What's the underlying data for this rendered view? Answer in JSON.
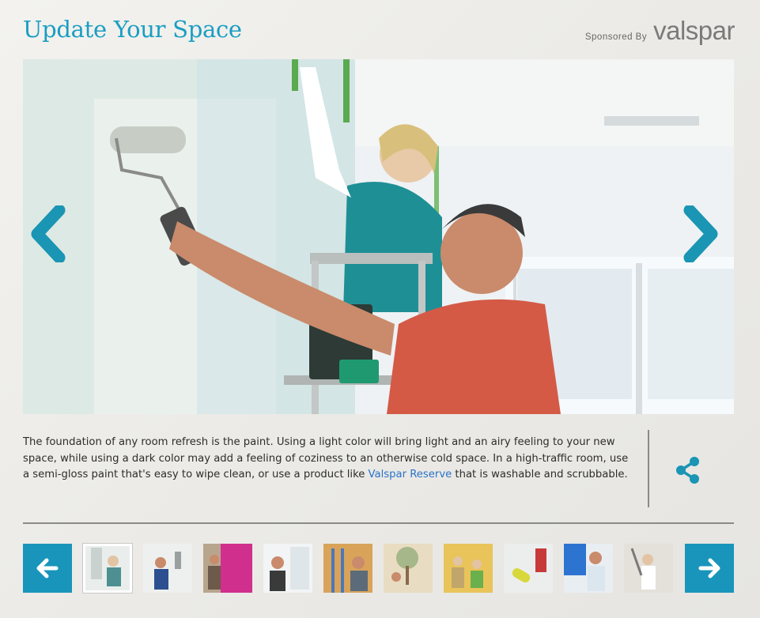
{
  "header": {
    "title": "Update Your Space",
    "sponsored_by": "Sponsored By",
    "brand": "valspar"
  },
  "hero": {
    "prev_icon": "chevron-left-icon",
    "next_icon": "chevron-right-icon",
    "image": "couple-painting-wall-photo"
  },
  "caption": {
    "text_before": "The foundation of any room refresh is the paint. Using a light color will bring light and an airy feeling to your new space, while using a dark color may add a feeling of coziness to an otherwise cold space. In a high-traffic room, use a semi-gloss paint that's easy to wipe clean, or use a product like ",
    "link": "Valspar Reserve",
    "text_after": " that is washable and scrubbable."
  },
  "share": {
    "icon": "share-icon"
  },
  "strip": {
    "prev_icon": "arrow-left-icon",
    "next_icon": "arrow-right-icon",
    "active_index": 0,
    "thumbnails": [
      "woman-painting-thumbnail",
      "man-roller-thumbnail",
      "pink-wall-couple-thumbnail",
      "man-window-thumbnail",
      "ladder-couple-thumbnail",
      "mural-family-thumbnail",
      "kids-painting-thumbnail",
      "yellow-roller-thumbnail",
      "blue-wall-man-thumbnail",
      "woman-roller-thumbnail"
    ]
  },
  "colors": {
    "accent": "#1a9ec2",
    "strip_button": "#1995bb",
    "link": "#2a73c9"
  }
}
